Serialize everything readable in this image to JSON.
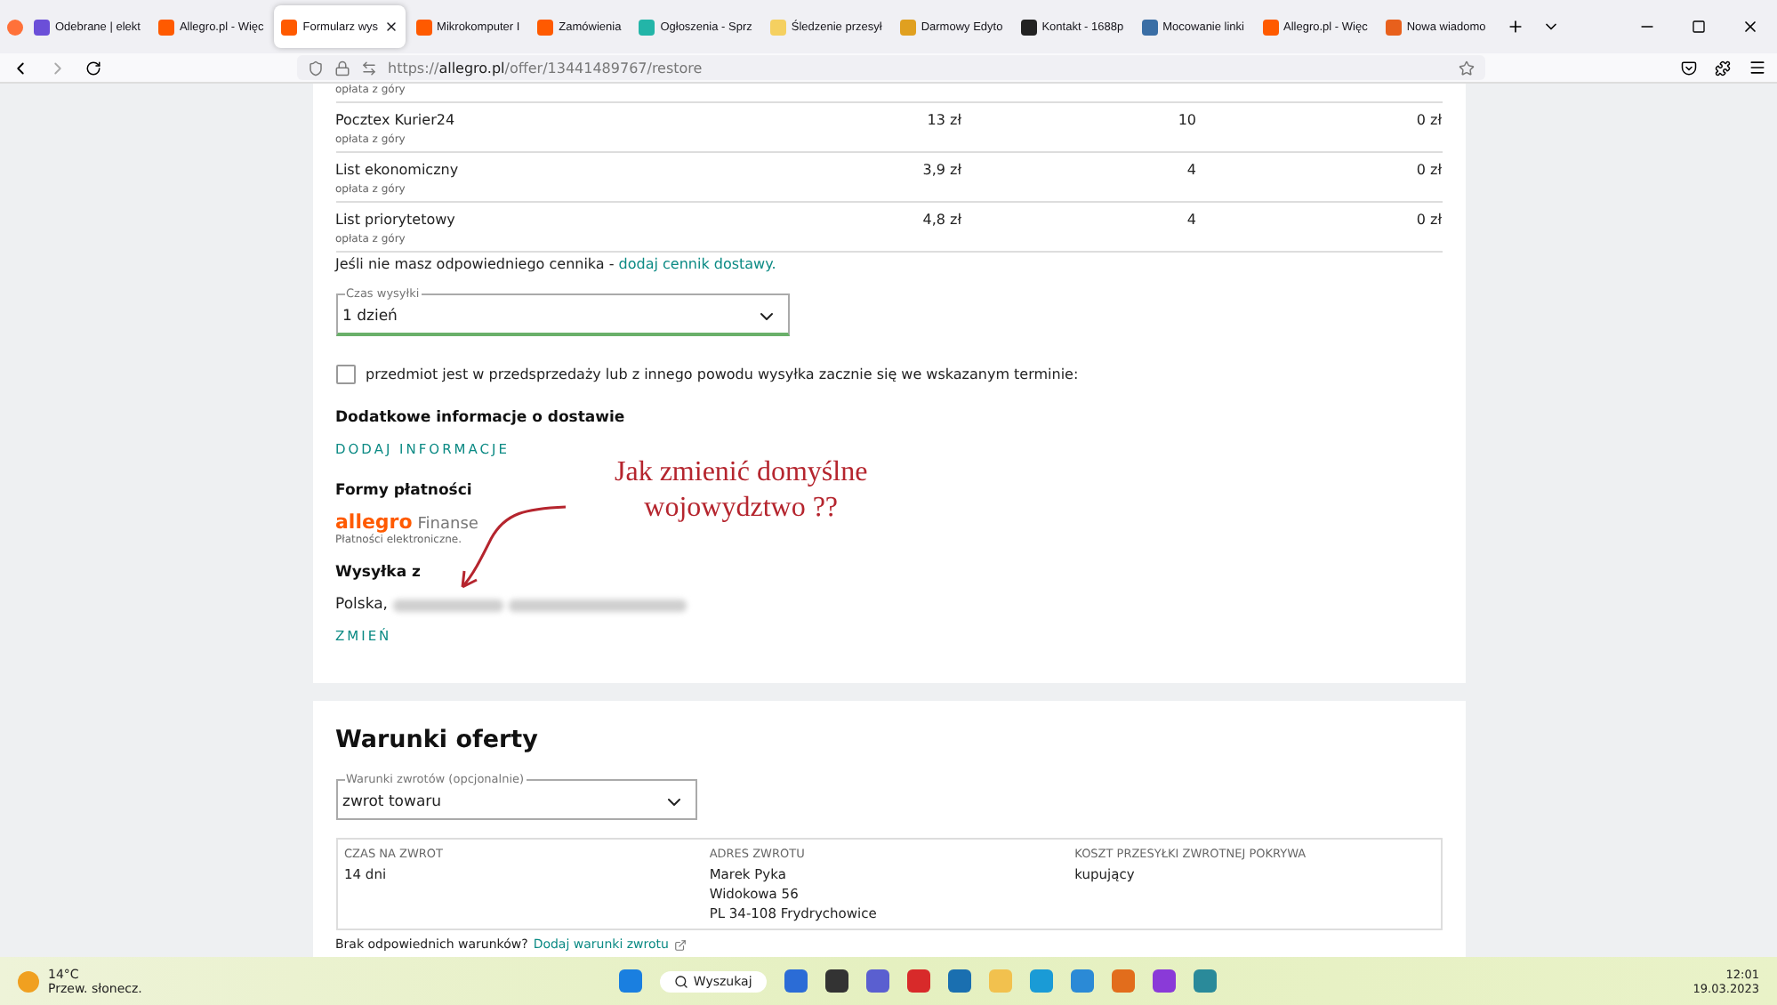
{
  "browser": {
    "tabs": [
      {
        "title": "Odebrane | elekt",
        "selected": false,
        "color": "#6b4fd8"
      },
      {
        "title": "Allegro.pl - Więc",
        "selected": false,
        "color": "#ff5a00"
      },
      {
        "title": "Formularz wys",
        "selected": true,
        "color": "#ff5a00"
      },
      {
        "title": "Mikrokomputer I",
        "selected": false,
        "color": "#ff5a00"
      },
      {
        "title": "Zamówienia",
        "selected": false,
        "color": "#ff5a00"
      },
      {
        "title": "Ogłoszenia - Sprz",
        "selected": false,
        "color": "#23b5a8"
      },
      {
        "title": "Śledzenie przesył",
        "selected": false,
        "color": "#f5d060"
      },
      {
        "title": "Darmowy Edyto",
        "selected": false,
        "color": "#e0a020"
      },
      {
        "title": "Kontakt - 1688p",
        "selected": false,
        "color": "#222222"
      },
      {
        "title": "Mocowanie linki",
        "selected": false,
        "color": "#3a6ea5"
      },
      {
        "title": "Allegro.pl - Więc",
        "selected": false,
        "color": "#ff5a00"
      },
      {
        "title": "Nowa wiadomo",
        "selected": false,
        "color": "#e8601c"
      }
    ],
    "url": {
      "scheme": "https://",
      "domain": "allegro.pl",
      "path": "/offer/13441489767/restore"
    }
  },
  "shipping": {
    "partial_row_note": "opłata z góry",
    "rows": [
      {
        "name": "Pocztex Kurier24",
        "note": "opłata z góry",
        "price": "13 zł",
        "quantity": "10",
        "cost": "0 zł"
      },
      {
        "name": "List ekonomiczny",
        "note": "opłata z góry",
        "price": "3,9 zł",
        "quantity": "4",
        "cost": "0 zł"
      },
      {
        "name": "List priorytetowy",
        "note": "opłata z góry",
        "price": "4,8 zł",
        "quantity": "4",
        "cost": "0 zł"
      }
    ],
    "hint_text": "Jeśli nie masz odpowiedniego cennika - ",
    "hint_link": "dodaj cennik dostawy.",
    "dispatch_select": {
      "label": "Czas wysyłki",
      "value": "1 dzień"
    },
    "presale_checkbox": {
      "label": "przedmiot jest w przedsprzedaży lub z innego powodu wysyłka zacznie się we wskazanym terminie:",
      "checked": false
    },
    "extra_info": {
      "heading": "Dodatkowe informacje o dostawie",
      "action": "DODAJ INFORMACJE"
    },
    "payment": {
      "heading": "Formy płatności",
      "logo": "allegro",
      "logo_suffix": "Finanse",
      "note": "Płatności elektroniczne."
    },
    "ship_from": {
      "heading": "Wysyłka z",
      "value": "Polska,",
      "action": "ZMIEŃ"
    }
  },
  "annotation": {
    "lines": [
      "Jak zmienić domyślne",
      "wojowydztwo ??"
    ]
  },
  "offer_terms": {
    "title": "Warunki oferty",
    "returns_select": {
      "label": "Warunki zwrotów (opcjonalnie)",
      "value": "zwrot towaru"
    },
    "columns": [
      {
        "heading": "CZAS NA ZWROT",
        "lines": [
          "14 dni"
        ]
      },
      {
        "heading": "ADRES ZWROTU",
        "lines": [
          "Marek Pyka",
          "Widokowa 56",
          "PL 34-108 Frydrychowice"
        ]
      },
      {
        "heading": "KOSZT PRZESYŁKI ZWROTNEJ POKRYWA",
        "lines": [
          "kupujący"
        ]
      }
    ],
    "footer_text": "Brak odpowiednich warunków?",
    "footer_link": "Dodaj warunki zwrotu"
  },
  "taskbar": {
    "temperature": "14°C",
    "condition": "Przew. słonecz.",
    "search": "Wyszukaj",
    "time": "12:01",
    "date": "19.03.2023"
  }
}
